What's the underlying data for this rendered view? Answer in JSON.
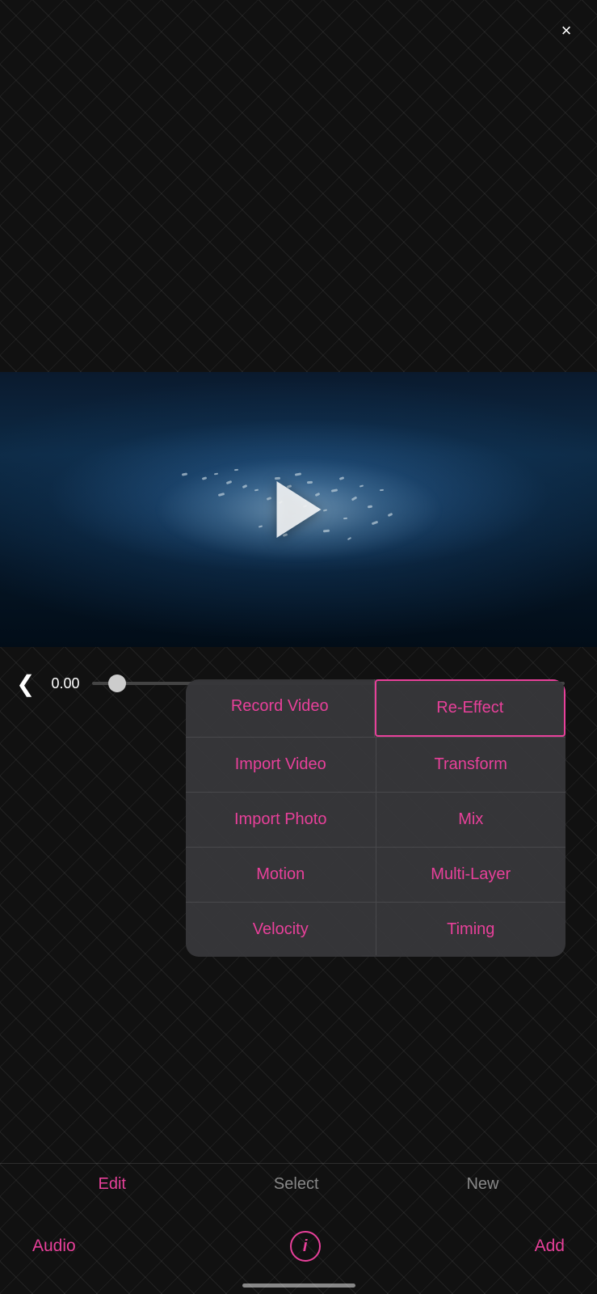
{
  "close_button": "×",
  "time": "0.00",
  "chevron": "❮",
  "menu": {
    "rows": [
      {
        "left": {
          "label": "Record Video",
          "active": false
        },
        "right": {
          "label": "Re-Effect",
          "active": true
        }
      },
      {
        "left": {
          "label": "Import Video",
          "active": false
        },
        "right": {
          "label": "Transform",
          "active": false
        }
      },
      {
        "left": {
          "label": "Import Photo",
          "active": false
        },
        "right": {
          "label": "Mix",
          "active": false
        }
      },
      {
        "left": {
          "label": "Motion",
          "active": false
        },
        "right": {
          "label": "Multi-Layer",
          "active": false
        }
      },
      {
        "left": {
          "label": "Velocity",
          "active": false
        },
        "right": {
          "label": "Timing",
          "active": false
        }
      }
    ]
  },
  "bottom_nav": {
    "items": [
      "Edit",
      "Select",
      "New"
    ],
    "active_index": 0
  },
  "footer": {
    "audio": "Audio",
    "add": "Add",
    "info": "i"
  },
  "play_button_label": "Play"
}
